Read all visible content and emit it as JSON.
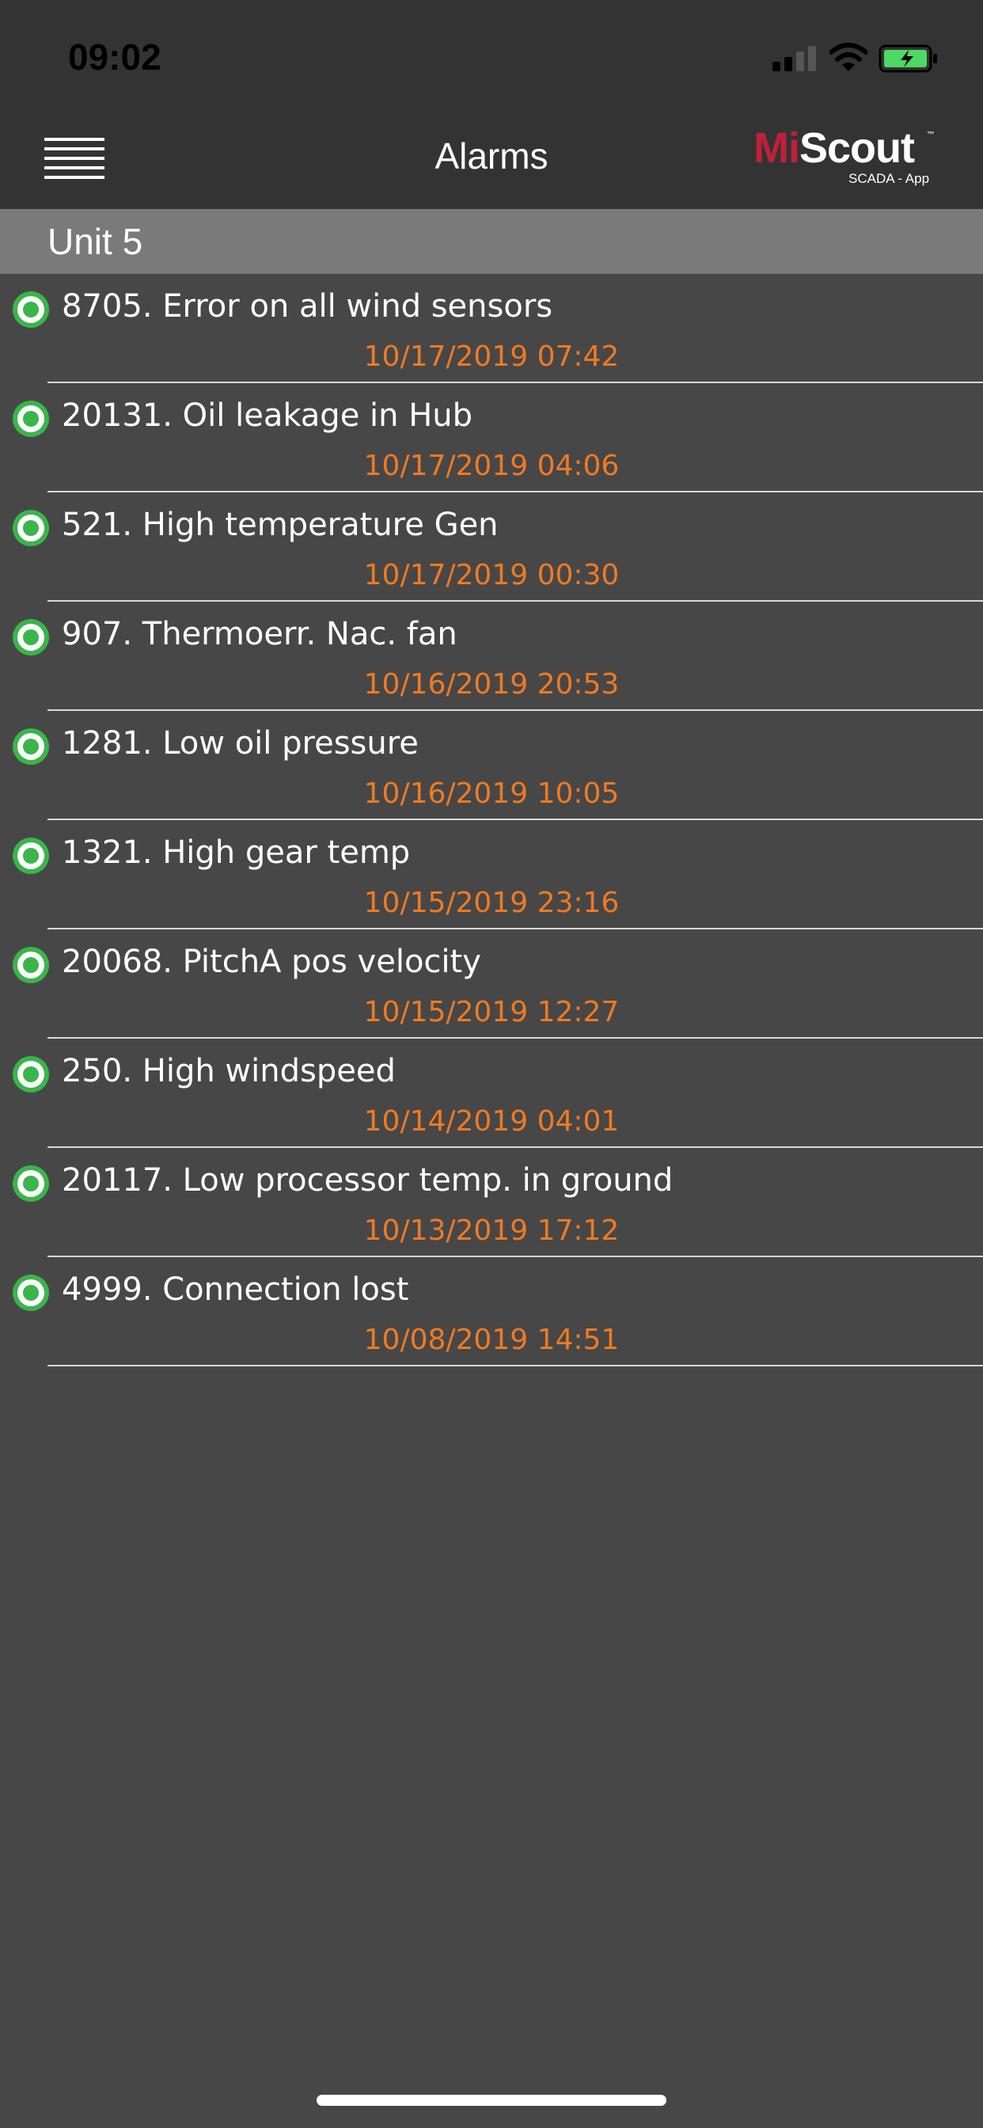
{
  "status_bar": {
    "time": "09:02",
    "signal_icon": "cellular-signal-icon",
    "wifi_icon": "wifi-icon",
    "battery_icon": "battery-charging-icon"
  },
  "nav": {
    "title": "Alarms",
    "menu_icon": "hamburger-menu-icon",
    "logo": {
      "part1": "Mi",
      "part2": "Scout",
      "tm": "™",
      "sub": "SCADA - App"
    }
  },
  "group": {
    "title": "Unit 5"
  },
  "alarms": [
    {
      "text": "8705. Error on all wind sensors",
      "time": "10/17/2019 07:42"
    },
    {
      "text": "20131. Oil leakage in Hub",
      "time": "10/17/2019 04:06"
    },
    {
      "text": "521. High temperature Gen",
      "time": "10/17/2019 00:30"
    },
    {
      "text": "907. Thermoerr. Nac. fan",
      "time": "10/16/2019 20:53"
    },
    {
      "text": "1281. Low oil pressure",
      "time": "10/16/2019 10:05"
    },
    {
      "text": "1321. High gear temp",
      "time": "10/15/2019 23:16"
    },
    {
      "text": "20068. PitchA pos velocity",
      "time": "10/15/2019 12:27"
    },
    {
      "text": "250. High windspeed",
      "time": "10/14/2019 04:01"
    },
    {
      "text": "20117. Low processor temp. in ground",
      "time": "10/13/2019 17:12"
    },
    {
      "text": "4999. Connection lost",
      "time": "10/08/2019 14:51"
    }
  ],
  "colors": {
    "background": "#474747",
    "bar": "#333333",
    "group_header": "#7a7a7a",
    "timestamp": "#f07a22",
    "status_ok": "#3ab54a",
    "brand_red": "#c0203a"
  }
}
